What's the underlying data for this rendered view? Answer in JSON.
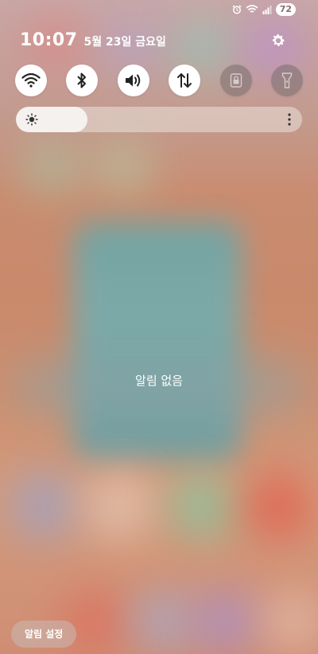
{
  "status_bar": {
    "battery": "72",
    "icons": [
      "alarm-icon",
      "wifi-signal-icon",
      "cell-signal-icon"
    ]
  },
  "header": {
    "time": "10:07",
    "date": "5월 23일 금요일"
  },
  "quick_settings": [
    {
      "icon": "wifi-icon",
      "state": "on"
    },
    {
      "icon": "bluetooth-icon",
      "state": "on"
    },
    {
      "icon": "sound-icon",
      "state": "on"
    },
    {
      "icon": "mobile-data-icon",
      "state": "on"
    },
    {
      "icon": "rotation-lock-icon",
      "state": "off"
    },
    {
      "icon": "flashlight-icon",
      "state": "off"
    }
  ],
  "brightness": {
    "level_percent": 25
  },
  "notifications": {
    "empty_label": "알림 없음"
  },
  "footer": {
    "settings_label": "알림 설정"
  },
  "colors": {
    "tile_on": "#ffffff",
    "tile_off": "#7a6e6e",
    "icon_dark": "#222222"
  }
}
